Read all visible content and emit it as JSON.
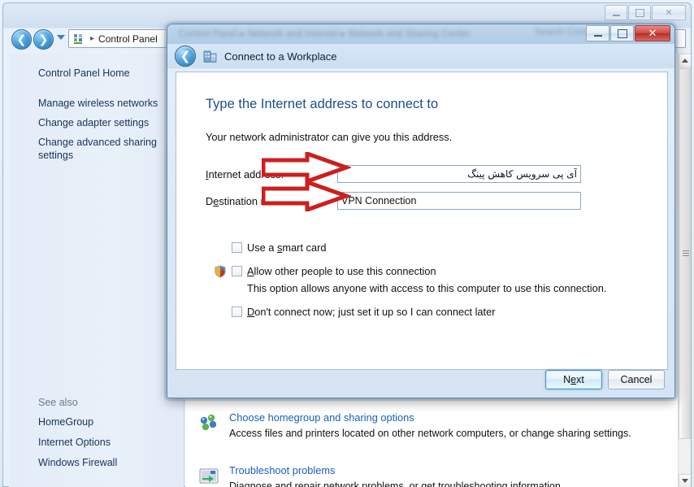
{
  "main_window": {
    "title_bar": {
      "minimize_label": "Minimize",
      "maximize_label": "Maximize",
      "close_label": "Close"
    },
    "address_bar": {
      "icon": "control-panel-icon",
      "separator": "▸",
      "path": "Control Panel"
    },
    "sidebar": {
      "home_label": "Control Panel Home",
      "links": [
        "Manage wireless networks",
        "Change adapter settings",
        "Change advanced sharing settings"
      ],
      "see_also_title": "See also",
      "see_also_links": [
        "HomeGroup",
        "Internet Options",
        "Windows Firewall"
      ]
    },
    "content_items": [
      {
        "icon": "homegroup-icon",
        "title": "Choose homegroup and sharing options",
        "description": "Access files and printers located on other network computers, or change sharing settings."
      },
      {
        "icon": "troubleshoot-icon",
        "title": "Troubleshoot problems",
        "description": "Diagnose and repair network problems, or get troubleshooting information."
      }
    ]
  },
  "dialog": {
    "background_blur_text_left": "Control Panel ▸ Network and Internet ▸ Network and Sharing Center",
    "background_blur_text_right": "Search Control Panel",
    "title": "Connect to a Workplace",
    "back_icon": "back-arrow-icon",
    "app_icon": "workplace-icon",
    "window_buttons": {
      "minimize_label": "Minimize",
      "maximize_label": "Maximize",
      "close_label": "✕"
    },
    "heading": "Type the Internet address to connect to",
    "subtext": "Your network administrator can give you this address.",
    "fields": [
      {
        "label_prefix": "",
        "label_underlined": "I",
        "label_rest": "nternet address:",
        "value": "آی پی سرویس کاهش پینگ",
        "rtl": true
      },
      {
        "label_prefix": "D",
        "label_underlined": "e",
        "label_rest": "stination name:",
        "value": "VPN Connection",
        "rtl": false
      }
    ],
    "checkboxes": [
      {
        "prefix": "Use a ",
        "underlined": "s",
        "rest": "mart card",
        "checked": false,
        "has_shield": false,
        "description": ""
      },
      {
        "prefix": "",
        "underlined": "A",
        "rest": "llow other people to use this connection",
        "checked": false,
        "has_shield": true,
        "description": "This option allows anyone with access to this computer to use this connection."
      },
      {
        "prefix": "",
        "underlined": "D",
        "rest": "on't connect now; just set it up so I can connect later",
        "checked": false,
        "has_shield": false,
        "description": ""
      }
    ],
    "buttons": {
      "next": {
        "prefix": "N",
        "underlined": "e",
        "rest": "xt",
        "primary": true
      },
      "cancel": {
        "prefix": "Cancel",
        "underlined": "",
        "rest": "",
        "primary": false
      }
    }
  },
  "annotations": {
    "arrow_color": "#cc1f1f",
    "arrow_fill": "#ffffff",
    "arrows": [
      {
        "name": "internet-address-pointer"
      },
      {
        "name": "destination-name-pointer"
      }
    ]
  }
}
